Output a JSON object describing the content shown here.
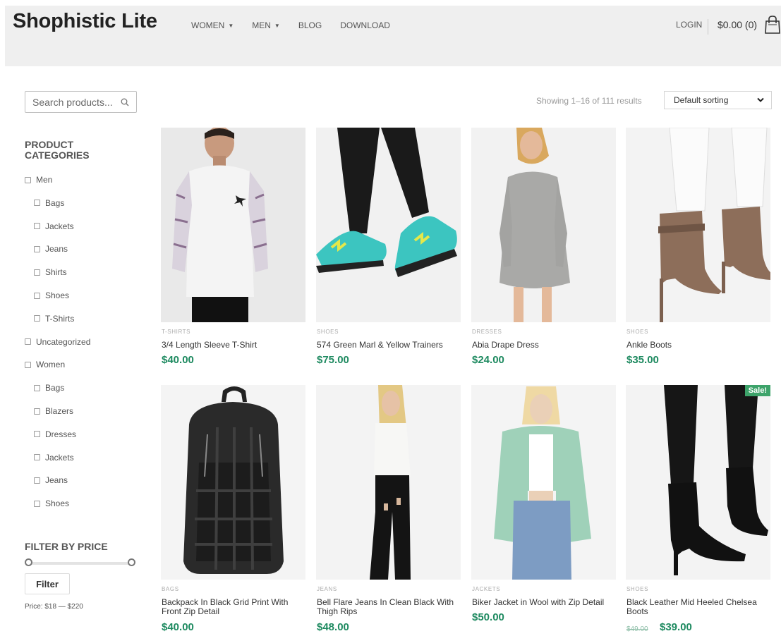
{
  "header": {
    "logo": "Shophistic Lite",
    "nav": [
      {
        "label": "WOMEN",
        "dropdown": true
      },
      {
        "label": "MEN",
        "dropdown": true
      },
      {
        "label": "BLOG",
        "dropdown": false
      },
      {
        "label": "DOWNLOAD",
        "dropdown": false
      }
    ],
    "login": "LOGIN",
    "cart_total": "$0.00 (0)"
  },
  "sidebar": {
    "search_placeholder": "Search products...",
    "categories_title": "PRODUCT CATEGORIES",
    "categories": [
      {
        "label": "Men",
        "level": 0
      },
      {
        "label": "Bags",
        "level": 1
      },
      {
        "label": "Jackets",
        "level": 1
      },
      {
        "label": "Jeans",
        "level": 1
      },
      {
        "label": "Shirts",
        "level": 1
      },
      {
        "label": "Shoes",
        "level": 1
      },
      {
        "label": "T-Shirts",
        "level": 1
      },
      {
        "label": "Uncategorized",
        "level": 0
      },
      {
        "label": "Women",
        "level": 0
      },
      {
        "label": "Bags",
        "level": 1
      },
      {
        "label": "Blazers",
        "level": 1
      },
      {
        "label": "Dresses",
        "level": 1
      },
      {
        "label": "Jackets",
        "level": 1
      },
      {
        "label": "Jeans",
        "level": 1
      },
      {
        "label": "Shoes",
        "level": 1
      }
    ],
    "filter_title": "FILTER BY PRICE",
    "filter_button": "Filter",
    "price_range": "Price: $18 — $220"
  },
  "toolbar": {
    "result_count": "Showing 1–16 of 111 results",
    "sort_selected": "Default sorting"
  },
  "products": [
    {
      "category": "T-SHIRTS",
      "title": "3/4 Length Sleeve T-Shirt",
      "price": "$40.00"
    },
    {
      "category": "SHOES",
      "title": "574 Green Marl & Yellow Trainers",
      "price": "$75.00"
    },
    {
      "category": "DRESSES",
      "title": "Abia Drape Dress",
      "price": "$24.00"
    },
    {
      "category": "SHOES",
      "title": "Ankle Boots",
      "price": "$35.00"
    },
    {
      "category": "BAGS",
      "title": "Backpack In Black Grid Print With Front Zip Detail",
      "price": "$40.00"
    },
    {
      "category": "JEANS",
      "title": "Bell Flare Jeans In Clean Black With Thigh Rips",
      "price": "$48.00"
    },
    {
      "category": "JACKETS",
      "title": "Biker Jacket in Wool with Zip Detail",
      "price": "$50.00"
    },
    {
      "category": "SHOES",
      "title": "Black Leather Mid Heeled Chelsea Boots",
      "price": "$39.00",
      "old_price": "$49.00",
      "sale": "Sale!"
    }
  ],
  "colors": {
    "price": "#1e8a60",
    "sale_badge": "#3da36a",
    "header_bg": "#efefef"
  }
}
